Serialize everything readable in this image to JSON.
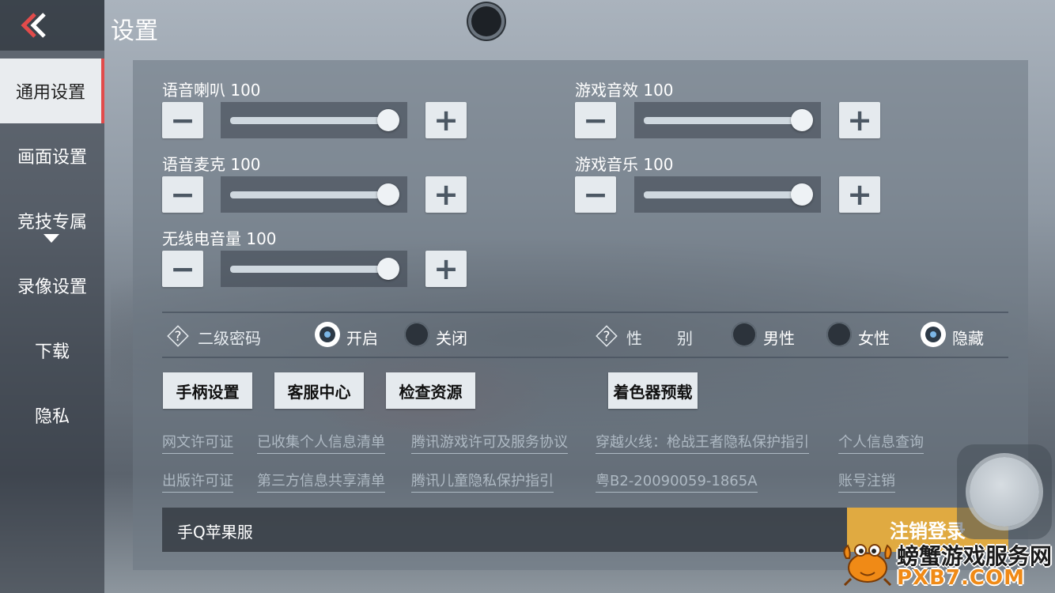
{
  "header": {
    "title": "设置"
  },
  "sidebar": {
    "items": [
      {
        "label": "通用设置",
        "active": true
      },
      {
        "label": "画面设置"
      },
      {
        "label": "竞技专属"
      },
      {
        "label": "录像设置"
      },
      {
        "label": "下载"
      },
      {
        "label": "隐私"
      }
    ]
  },
  "volumes": [
    {
      "label": "语音喇叭 100",
      "value": 100
    },
    {
      "label": "游戏音效 100",
      "value": 100
    },
    {
      "label": "语音麦克 100",
      "value": 100
    },
    {
      "label": "游戏音乐 100",
      "value": 100
    },
    {
      "label": "无线电音量 100",
      "value": 100
    }
  ],
  "options": {
    "password": {
      "label": "二级密码",
      "choices": [
        "开启",
        "关闭"
      ],
      "selected": "开启"
    },
    "gender": {
      "label_a": "性",
      "label_b": "别",
      "choices": [
        "男性",
        "女性",
        "隐藏"
      ],
      "selected": "隐藏"
    }
  },
  "buttons": {
    "controller": "手柄设置",
    "service": "客服中心",
    "check": "检查资源",
    "shader": "着色器预载"
  },
  "links": {
    "row1": [
      "网文许可证",
      "已收集个人信息清单",
      "腾讯游戏许可及服务协议",
      "穿越火线：枪战王者隐私保护指引",
      "个人信息查询"
    ],
    "row2": [
      "出版许可证",
      "第三方信息共享清单",
      "腾讯儿童隐私保护指引",
      "粤B2-20090059-1865A",
      "账号注销"
    ]
  },
  "account": {
    "server": "手Q苹果服",
    "logout": "注销登录"
  },
  "watermark": {
    "line1": "螃蟹游戏服务网",
    "line2": "PXB7.COM"
  },
  "colors": {
    "accent": "#e24b4b",
    "logout": "#e0aa41",
    "watermark_orange": "#f08a16"
  }
}
